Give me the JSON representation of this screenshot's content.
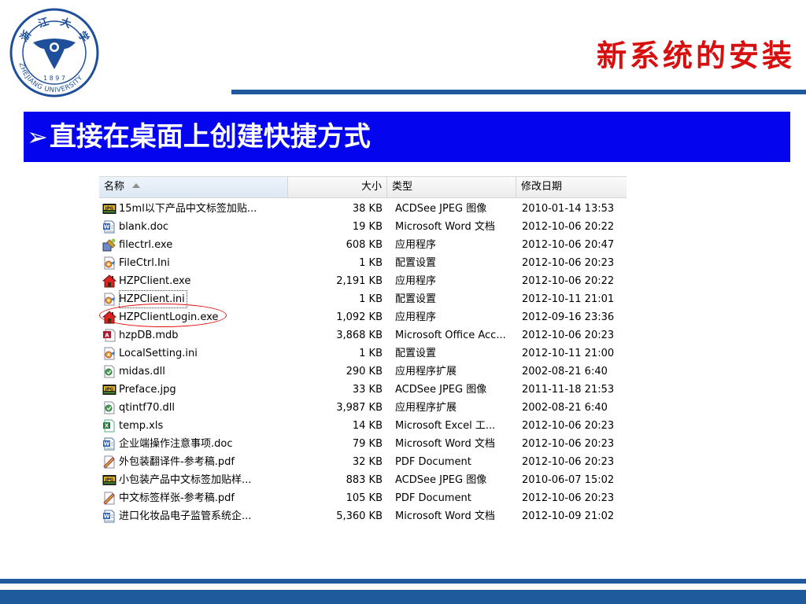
{
  "slide": {
    "title": "新系统的安装",
    "subtitle": "直接在桌面上创建快捷方式",
    "bullet_arrow": "➢"
  },
  "colors": {
    "title": "#d80f0f",
    "banner": "#0404ee",
    "rule": "#1f5b9c",
    "highlight": "#e31010"
  },
  "explorer": {
    "columns": {
      "name": "名称",
      "size": "大小",
      "type": "类型",
      "date": "修改日期"
    },
    "sort_column": "name",
    "files": [
      {
        "name": "15ml以下产品中文标签加贴...",
        "size": "38 KB",
        "type": "ACDSee JPEG 图像",
        "date": "2010-01-14 13:53",
        "icon": "jpeg-icon"
      },
      {
        "name": "blank.doc",
        "size": "19 KB",
        "type": "Microsoft Word 文档",
        "date": "2012-10-06 20:22",
        "icon": "word-doc-icon"
      },
      {
        "name": "filectrl.exe",
        "size": "608 KB",
        "type": "应用程序",
        "date": "2012-10-06 20:47",
        "icon": "exe-tool-icon"
      },
      {
        "name": "FileCtrl.Ini",
        "size": "1 KB",
        "type": "配置设置",
        "date": "2012-10-06 20:23",
        "icon": "ini-settings-icon"
      },
      {
        "name": "HZPClient.exe",
        "size": "2,191 KB",
        "type": "应用程序",
        "date": "2012-10-06 20:22",
        "icon": "house-app-icon"
      },
      {
        "name": "HZPClient.ini",
        "size": "1 KB",
        "type": "配置设置",
        "date": "2012-10-11 21:01",
        "icon": "ini-settings-icon"
      },
      {
        "name": "HZPClientLogin.exe",
        "size": "1,092 KB",
        "type": "应用程序",
        "date": "2012-09-16 23:36",
        "icon": "house-app-icon"
      },
      {
        "name": "hzpDB.mdb",
        "size": "3,868 KB",
        "type": "Microsoft Office Acc...",
        "date": "2012-10-06 20:23",
        "icon": "access-db-icon"
      },
      {
        "name": "LocalSetting.ini",
        "size": "1 KB",
        "type": "配置设置",
        "date": "2012-10-11 21:00",
        "icon": "ini-settings-icon"
      },
      {
        "name": "midas.dll",
        "size": "290 KB",
        "type": "应用程序扩展",
        "date": "2002-08-21 6:40",
        "icon": "dll-icon"
      },
      {
        "name": "Preface.jpg",
        "size": "33 KB",
        "type": "ACDSee JPEG 图像",
        "date": "2011-11-18 21:53",
        "icon": "jpeg-icon"
      },
      {
        "name": "qtintf70.dll",
        "size": "3,987 KB",
        "type": "应用程序扩展",
        "date": "2002-08-21 6:40",
        "icon": "dll-icon"
      },
      {
        "name": "temp.xls",
        "size": "14 KB",
        "type": "Microsoft Excel 工...",
        "date": "2012-10-06 20:23",
        "icon": "excel-icon"
      },
      {
        "name": "企业端操作注意事项.doc",
        "size": "79 KB",
        "type": "Microsoft Word 文档",
        "date": "2012-10-06 20:23",
        "icon": "word-doc-icon"
      },
      {
        "name": "外包装翻译件-参考稿.pdf",
        "size": "32 KB",
        "type": "PDF Document",
        "date": "2012-10-06 20:23",
        "icon": "pdf-icon"
      },
      {
        "name": "小包装产品中文标签加贴样...",
        "size": "883 KB",
        "type": "ACDSee JPEG 图像",
        "date": "2010-06-07 15:02",
        "icon": "jpeg-icon"
      },
      {
        "name": "中文标签样张-参考稿.pdf",
        "size": "105 KB",
        "type": "PDF Document",
        "date": "2012-10-06 20:23",
        "icon": "pdf-icon"
      },
      {
        "name": "进口化妆品电子监管系统企...",
        "size": "5,360 KB",
        "type": "Microsoft Word 文档",
        "date": "2012-10-09 21:02",
        "icon": "word-doc-icon"
      }
    ],
    "focused_row": 5,
    "highlighted_row": 6
  },
  "logo": {
    "name": "university-seal-icon",
    "text_top": "浙 江 大 学",
    "text_ring": "ZHEJIANG UNIVERSITY",
    "year": "1 8 9 7"
  }
}
